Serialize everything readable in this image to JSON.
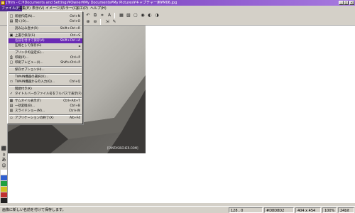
{
  "window": {
    "title": "JTrim - C:¥Documents and Settings¥Owner¥My Documents¥My Pictures¥キャプチャー用¥M06.jpg",
    "minimize": "_",
    "maximize": "□",
    "close": "×"
  },
  "menubar": [
    {
      "label": "ファイル(F)"
    },
    {
      "label": "編集(E)"
    },
    {
      "label": "表示(V)"
    },
    {
      "label": "イメージ(I)"
    },
    {
      "label": "カラー(C)"
    },
    {
      "label": "加工(P)"
    },
    {
      "label": "ヘルプ(H)"
    }
  ],
  "file_menu": {
    "items": [
      {
        "label": "新規作成(N)...",
        "shortcut": "Ctrl+N",
        "icon": "□"
      },
      {
        "label": "開く(O)...",
        "shortcut": "Ctrl+O",
        "icon": "▤"
      },
      {
        "label": "読み込み直す(R)",
        "shortcut": "Shift+Ctrl+R",
        "icon": ""
      },
      {
        "label": "上書き保存(S)",
        "shortcut": "Ctrl+S",
        "icon": "▣"
      },
      {
        "label": "名前を付けて保存(A)",
        "shortcut": "Shift+Ctrl+A",
        "icon": ""
      },
      {
        "label": "圧縮として保存(G)",
        "shortcut": "",
        "icon": "",
        "arrow": "►"
      },
      {
        "label": "プリンタの設定(E)...",
        "shortcut": "",
        "icon": ""
      },
      {
        "label": "印刷(P)...",
        "shortcut": "Ctrl+P",
        "icon": "⎙"
      },
      {
        "label": "印刷プレビュー(I)...",
        "shortcut": "Shift+Ctrl+P",
        "icon": "▢"
      },
      {
        "label": "保存オプション(H)...",
        "shortcut": "",
        "icon": ""
      },
      {
        "label": "TWAIN機器の選択(U)...",
        "shortcut": "",
        "icon": ""
      },
      {
        "label": "TWAIN機器からの入力(Q)...",
        "shortcut": "Ctrl+Q",
        "icon": "▭"
      },
      {
        "label": "閲歴付き(K)",
        "shortcut": "",
        "icon": ""
      },
      {
        "label": "タイトルバーのファイル名をフルパスで表示(F)",
        "shortcut": "",
        "icon": "✓"
      },
      {
        "label": "サムネイル表示(T)",
        "shortcut": "Ctrl+Alt+T",
        "icon": "▦"
      },
      {
        "label": "一括変換(B)...",
        "shortcut": "Ctrl+B",
        "icon": "▤"
      },
      {
        "label": "スライドショー(M)...",
        "shortcut": "Ctrl+W",
        "icon": "▥"
      },
      {
        "label": "アプリケーションの終了(X)",
        "shortcut": "Alt+F4",
        "icon": "▫"
      }
    ],
    "selected_index": 4
  },
  "toolbar": {
    "icons": [
      "file-new-icon",
      "open-icon",
      "save-icon",
      "undo-icon",
      "copy-icon",
      "crop-icon",
      "text-icon",
      "grid-icon",
      "frame-icon",
      "select-icon",
      "fill-icon",
      "contrast-icon",
      "color-icon",
      "zoom-in-icon",
      "zoom-out-icon",
      "fit-icon",
      "eyedropper-icon"
    ],
    "glyphs": [
      "□",
      "▤",
      "▣",
      "↶",
      "⧉",
      "⌗",
      "A",
      "▦",
      "▧",
      "▢",
      "◉",
      "◐",
      "◑",
      "⊕",
      "⊖",
      "⇲",
      "✎"
    ]
  },
  "left_tools": [
    "⬛",
    "⌂",
    "あ",
    "☺",
    "▫",
    "▪",
    "▪",
    "▪",
    "▪",
    "▪"
  ],
  "photo": {
    "watermark": "[FANTASISCHER.COM]",
    "colors": {
      "bg": "#4a4846",
      "key": "#b9b7b1"
    }
  },
  "statusbar": {
    "message": "画像に新しい名前を付けて保存します。",
    "coords": "128 , 0",
    "color": "#D8D8D2",
    "size": "404 x 454",
    "zoom": "100%",
    "bits": "24bit"
  },
  "colors": {
    "selected": "#6a2bb5",
    "title_start": "#6a2bb5",
    "title_end": "#a77adf"
  }
}
